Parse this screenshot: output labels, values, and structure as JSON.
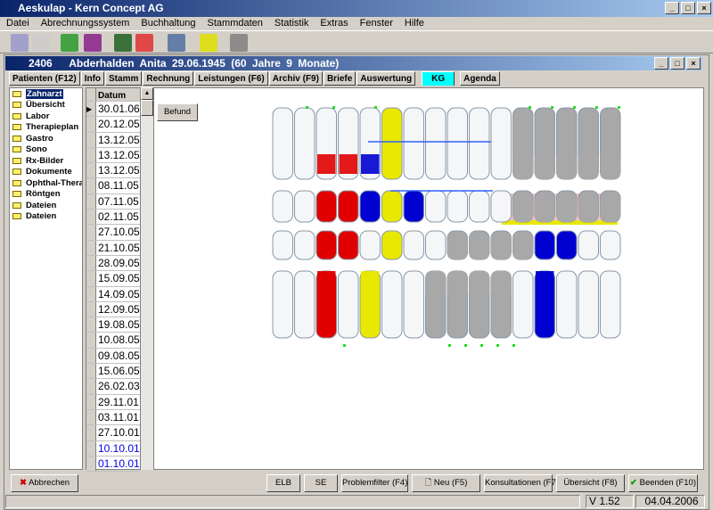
{
  "app": {
    "title": "Aeskulap - Kern Concept AG",
    "min": "_",
    "max": "□",
    "close": "×"
  },
  "menu": [
    "Datei",
    "Abrechnungssystem",
    "Buchhaltung",
    "Stammdaten",
    "Statistik",
    "Extras",
    "Fenster",
    "Hilfe"
  ],
  "toolbar_icons": [
    "edit-icon",
    "copy-icon",
    "money-icon",
    "save-icon",
    "book-icon",
    "chart-icon",
    "fax-icon",
    "lock-icon",
    "barcode-icon"
  ],
  "patient": {
    "id": "2406",
    "name": "Abderhalden Anita",
    "dob": "29.06.1945",
    "age": "(60 Jahre 9 Monate)"
  },
  "tabs": [
    "Patienten (F12)",
    "Info",
    "Stamm",
    "Rechnung",
    "Leistungen (F6)",
    "Archiv (F9)",
    "Briefe",
    "Auswertung",
    "KG",
    "Agenda"
  ],
  "active_tab": "KG",
  "tree": [
    "Zahnarzt",
    "Übersicht",
    "Labor",
    "Therapieplan",
    "Gastro",
    "Sono",
    "Rx-Bilder",
    "Dokumente",
    "Ophthal-Thera",
    "Röntgen",
    "Dateien",
    "Dateien"
  ],
  "dates": {
    "header": "Datum",
    "rows": [
      "30.01.06",
      "20.12.05",
      "13.12.05",
      "13.12.05",
      "13.12.05",
      "08.11.05",
      "07.11.05",
      "02.11.05",
      "27.10.05",
      "21.10.05",
      "28.09.05",
      "15.09.05",
      "14.09.05",
      "12.09.05",
      "19.08.05",
      "10.08.05",
      "09.08.05",
      "15.06.05",
      "26.02.03",
      "29.11.01",
      "03.11.01",
      "27.10.01",
      "10.10.01",
      "01.10.01"
    ],
    "blue_rows": [
      22,
      23
    ]
  },
  "befund": "Befund",
  "teeth": {
    "upper": [
      "w",
      "w",
      "rw",
      "rw",
      "bw",
      "y",
      "w",
      "w",
      "w",
      "w",
      "w",
      "g",
      "g",
      "g",
      "g",
      "g"
    ],
    "upper_occ": [
      "w",
      "w",
      "r",
      "r",
      "b",
      "y",
      "b",
      "w",
      "w",
      "w",
      "w",
      "g",
      "g",
      "g",
      "g",
      "g"
    ],
    "lower_occ": [
      "w",
      "w",
      "r",
      "r",
      "w",
      "y",
      "w",
      "w",
      "g",
      "g",
      "g",
      "g",
      "b",
      "b",
      "w",
      "w"
    ],
    "lower": [
      "w",
      "w",
      "r",
      "w",
      "y",
      "w",
      "w",
      "g",
      "g",
      "g",
      "g",
      "w",
      "b",
      "w",
      "w",
      "w"
    ]
  },
  "colors": {
    "red": "#e00000",
    "blue": "#0000d0",
    "yellow": "#e8e800",
    "grey": "#a8a8a8",
    "pink": "#f4c0c8",
    "accent": "#00ffff"
  },
  "buttons": {
    "cancel": "Abbrechen",
    "elb": "ELB",
    "se": "SE",
    "problemfilter": "Problemfilter (F4)",
    "neu": "Neu (F5)",
    "konsultationen": "Konsultationen (F7)",
    "uebersicht": "Übersicht (F8)",
    "beenden": "Beenden (F10)"
  },
  "status": {
    "version": "V 1.52",
    "date": "04.04.2006"
  }
}
